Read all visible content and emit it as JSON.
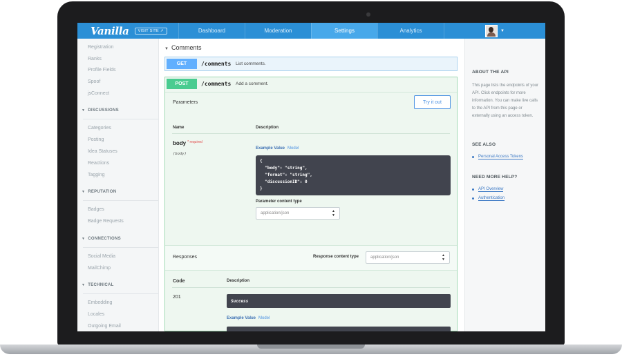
{
  "topnav": {
    "logo": "Vanilla",
    "visit_site": "VISIT SITE ↗",
    "tabs": [
      "Dashboard",
      "Moderation",
      "Settings",
      "Analytics"
    ],
    "active_tab": "Settings"
  },
  "sidebar": {
    "top_items": [
      "Registration",
      "Ranks",
      "Profile Fields",
      "Spoof",
      "jsConnect"
    ],
    "sections": [
      {
        "title": "DISCUSSIONS",
        "items": [
          "Categories",
          "Posting",
          "Idea Statuses",
          "Reactions",
          "Tagging"
        ]
      },
      {
        "title": "REPUTATION",
        "items": [
          "Badges",
          "Badge Requests"
        ]
      },
      {
        "title": "CONNECTIONS",
        "items": [
          "Social Media",
          "MailChimp"
        ]
      },
      {
        "title": "TECHNICAL",
        "items": [
          "Embedding",
          "Locales",
          "Outgoing Email"
        ]
      }
    ]
  },
  "main": {
    "section_title": "Comments",
    "get": {
      "method": "GET",
      "path": "/comments",
      "description": "List comments."
    },
    "post": {
      "method": "POST",
      "path": "/comments",
      "description": "Add a comment.",
      "parameters_label": "Parameters",
      "try_it_out": "Try it out",
      "col_name": "Name",
      "col_description": "Description",
      "param_name": "body",
      "required": "* required",
      "param_type": "(body)",
      "example_value": "Example Value",
      "model": "Model",
      "code": "{\n  \"body\": \"string\",\n  \"format\": \"string\",\n  \"discussionID\": 0\n}",
      "param_content_type_label": "Parameter content type",
      "param_content_type_value": "application/json",
      "responses_label": "Responses",
      "response_content_type_label": "Response content type",
      "response_content_type_value": "application/json",
      "col_code": "Code",
      "col_resp_description": "Description",
      "response_code": "201",
      "response_desc": "Success",
      "example_value_2": "Example Value",
      "model_2": "Model"
    }
  },
  "right_sidebar": {
    "about_title": "ABOUT THE API",
    "about_text": "This page lists the endpoints of your API. Click endpoints for more information. You can make live calls to the API from this page or externally using an access token.",
    "see_also_title": "SEE ALSO",
    "see_also_links": [
      "Personal Access Tokens"
    ],
    "help_title": "NEED MORE HELP?",
    "help_links": [
      "API Overview",
      "Authentication"
    ]
  },
  "colors": {
    "nav_blue": "#2b8fd6",
    "nav_active": "#47a8ea",
    "get_method": "#61affe",
    "post_method": "#49cc90",
    "code_bg": "#41444e",
    "link": "#3b78c4"
  }
}
